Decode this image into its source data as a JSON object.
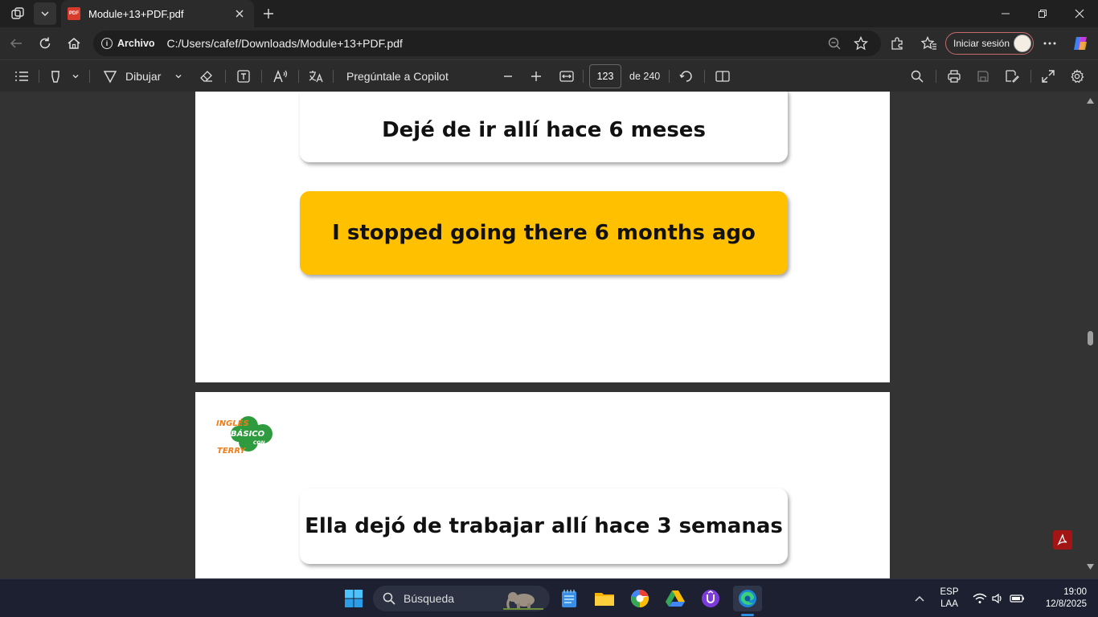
{
  "browser": {
    "tab_title": "Module+13+PDF.pdf",
    "tab_favicon_text": "PDF",
    "address_prefix": "Archivo",
    "url": "C:/Users/cafef/Downloads/Module+13+PDF.pdf",
    "signin_label": "Iniciar sesión"
  },
  "pdf_toolbar": {
    "draw_label": "Dibujar",
    "copilot_label": "Pregúntale a Copilot",
    "current_page": "123",
    "total_pages_label": "de 240"
  },
  "document": {
    "page1_card1": "Dejé de ir allí hace 6 meses",
    "page1_card2": "I stopped going there 6 months ago",
    "page2_card1": "Ella dejó de trabajar allí hace 3 semanas",
    "logo": {
      "line1": "INGLÉS",
      "line2": "BÁSICO",
      "line3": "CON",
      "line4": "TERRY"
    }
  },
  "colors": {
    "card_highlight": "#ffc000",
    "logo_green": "#2e9b3f",
    "logo_orange": "#ef7d1a",
    "edge_accent": "#2d8ee0"
  },
  "taskbar": {
    "search_placeholder": "Búsqueda",
    "lang_line1": "ESP",
    "lang_line2": "LAA",
    "time": "19:00",
    "date": "12/8/2025"
  }
}
